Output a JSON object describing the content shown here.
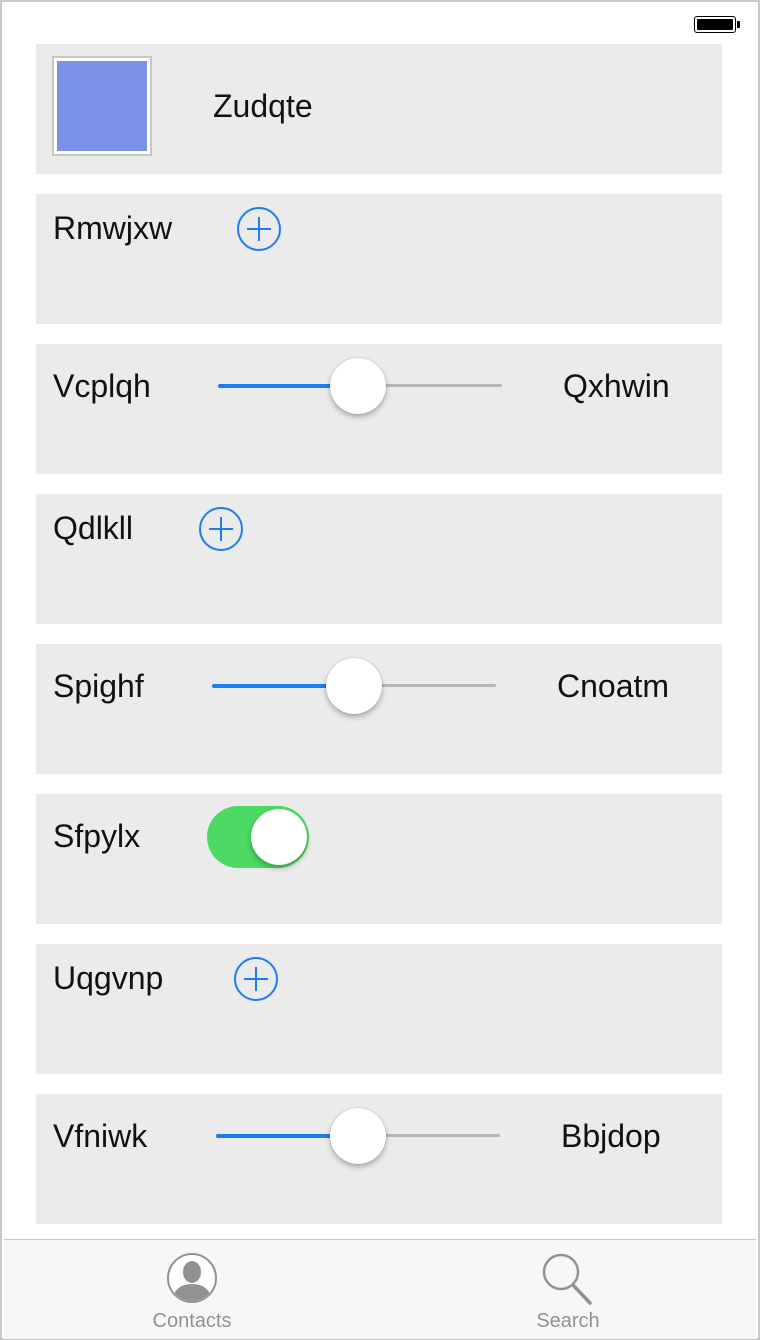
{
  "status_bar": {
    "battery_icon": "battery-icon"
  },
  "rows": [
    {
      "kind": "avatar",
      "label": "Zudqte",
      "avatar_color": "#7a93e6"
    },
    {
      "kind": "add",
      "label": "Rmwjxw",
      "icon": "plus-circle-icon"
    },
    {
      "kind": "slider",
      "label": "Vcplqh",
      "value_label": "Qxhwin",
      "value": 0.49
    },
    {
      "kind": "add",
      "label": "Qdlkll",
      "icon": "plus-circle-icon"
    },
    {
      "kind": "slider",
      "label": "Spighf",
      "value_label": "Cnoatm",
      "value": 0.5
    },
    {
      "kind": "toggle",
      "label": "Sfpylx",
      "on": true
    },
    {
      "kind": "add",
      "label": "Uqgvnp",
      "icon": "plus-circle-icon"
    },
    {
      "kind": "slider",
      "label": "Vfniwk",
      "value_label": "Bbjdop",
      "value": 0.5
    }
  ],
  "tabbar": {
    "tabs": [
      {
        "label": "Contacts",
        "icon": "contact-icon"
      },
      {
        "label": "Search",
        "icon": "search-icon"
      }
    ]
  },
  "colors": {
    "accent": "#1a7ef2",
    "toggle_on": "#4cd964",
    "card_bg": "#ebebeb",
    "tab_inactive": "#929292"
  }
}
